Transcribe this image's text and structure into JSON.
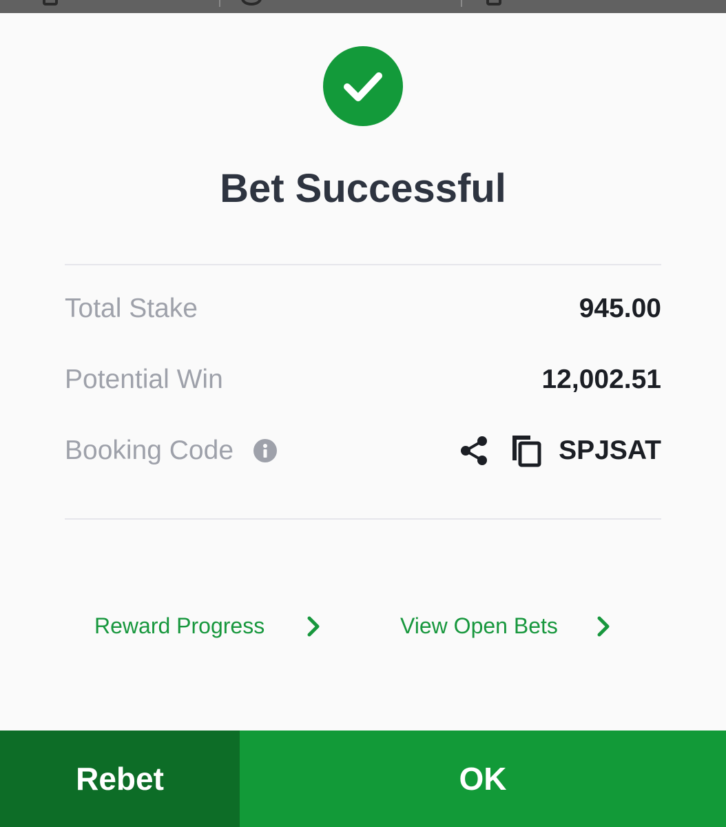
{
  "dialog": {
    "title": "Bet Successful",
    "status_icon": "check-circle-icon"
  },
  "details": {
    "total_stake_label": "Total Stake",
    "total_stake_value": "945.00",
    "potential_win_label": "Potential Win",
    "potential_win_value": "12,002.51",
    "booking_code_label": "Booking Code",
    "booking_code_value": "SPJSAT"
  },
  "links": {
    "reward_progress": "Reward Progress",
    "view_open_bets": "View Open Bets"
  },
  "footer": {
    "rebet_label": "Rebet",
    "ok_label": "OK"
  },
  "colors": {
    "brand_green": "#139a3a",
    "dark_green": "#0d6d27",
    "link_green": "#17973d",
    "title_text": "#2e3440",
    "muted_label": "#9ea1aa"
  }
}
